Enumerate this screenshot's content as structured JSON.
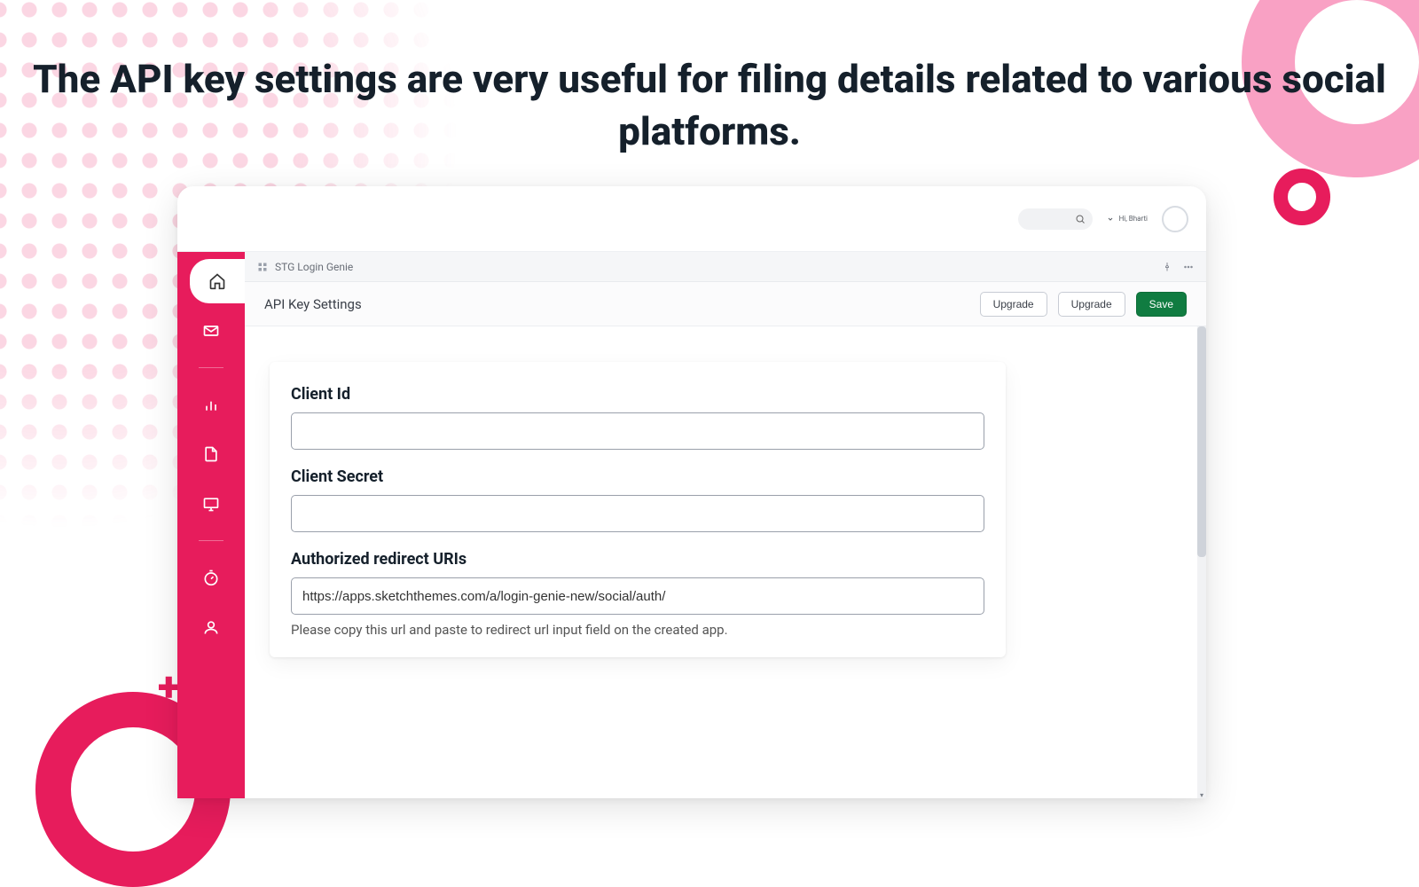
{
  "headline": "The API key settings are very useful for filing details related to various social platforms.",
  "topbar": {
    "orders_label": "Hi, Bharti"
  },
  "breadcrumb": "STG Login Genie",
  "section": {
    "title": "API Key Settings",
    "upgrade": "Upgrade",
    "upgrade2": "Upgrade",
    "save": "Save"
  },
  "form": {
    "client_id_label": "Client Id",
    "client_id_value": "",
    "client_secret_label": "Client Secret",
    "client_secret_value": "",
    "redirect_label": "Authorized redirect URIs",
    "redirect_value": "https://apps.sketchthemes.com/a/login-genie-new/social/auth/",
    "redirect_hint": "Please copy this url and paste to redirect url input field on the created app."
  }
}
